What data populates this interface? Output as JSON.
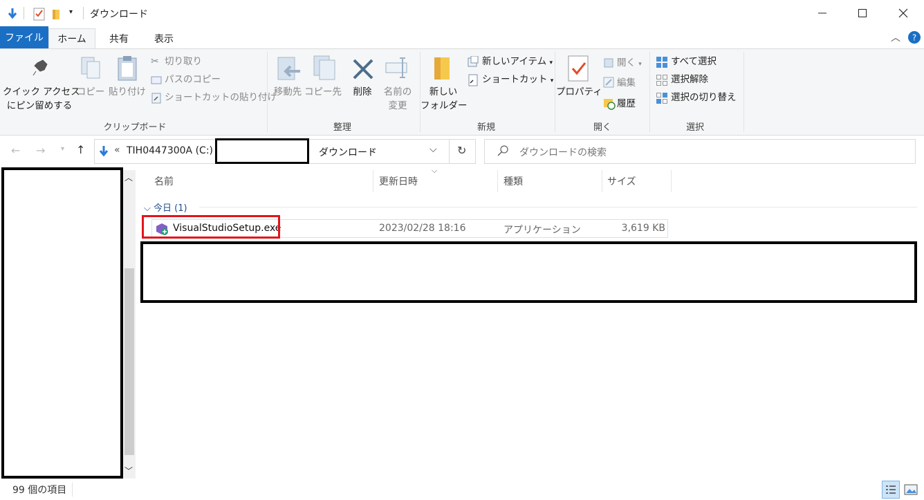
{
  "window": {
    "title": "ダウンロード"
  },
  "tabs": {
    "file": "ファイル",
    "home": "ホーム",
    "share": "共有",
    "view": "表示"
  },
  "ribbon": {
    "clipboard": {
      "pin": [
        "クイック アクセス",
        "にピン留めする"
      ],
      "copy": "コピー",
      "paste": "貼り付け",
      "cut": "切り取り",
      "copy_path": "パスのコピー",
      "paste_shortcut": "ショートカットの貼り付け",
      "label": "クリップボード"
    },
    "organize": {
      "move_to": "移動先",
      "copy_to": "コピー先",
      "delete": "削除",
      "rename": [
        "名前の",
        "変更"
      ],
      "label": "整理"
    },
    "new": {
      "new_folder": [
        "新しい",
        "フォルダー"
      ],
      "new_item": "新しいアイテム",
      "shortcut": "ショートカット",
      "label": "新規"
    },
    "open": {
      "properties": "プロパティ",
      "open": "開く",
      "edit": "編集",
      "history": "履歴",
      "label": "開く"
    },
    "select": {
      "select_all": "すべて選択",
      "select_none": "選択解除",
      "invert": "選択の切り替え",
      "label": "選択"
    }
  },
  "address": {
    "prefix": "«",
    "drive": "TIH0447300A (C:)",
    "folder": "ダウンロード",
    "search_placeholder": "ダウンロードの検索"
  },
  "columns": {
    "name": "名前",
    "date": "更新日時",
    "type": "種類",
    "size": "サイズ"
  },
  "group": {
    "label": "今日 (1)"
  },
  "files": [
    {
      "name": "VisualStudioSetup.exe",
      "date": "2023/02/28 18:16",
      "type": "アプリケーション",
      "size": "3,619 KB"
    }
  ],
  "status": {
    "count": "99 個の項目"
  },
  "colors": {
    "accent": "#1a6fc4",
    "highlight_box": "#e4131a",
    "redaction": "#000000"
  }
}
